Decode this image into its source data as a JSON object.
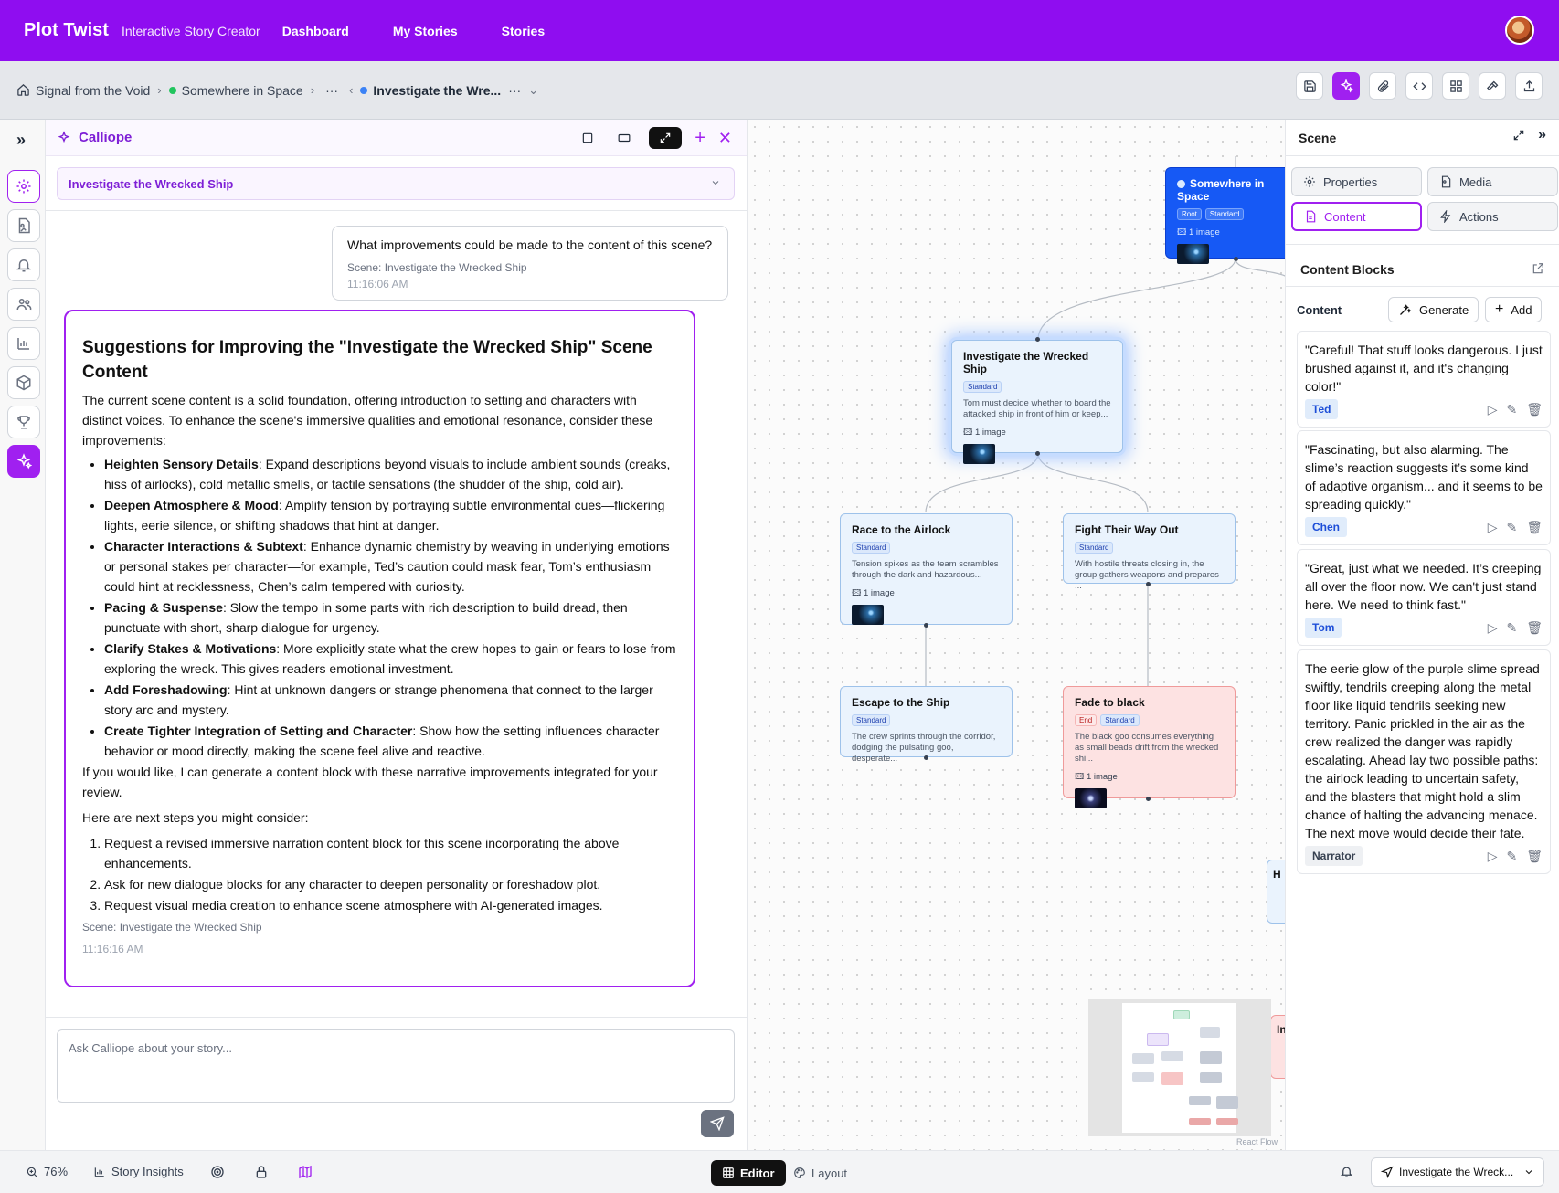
{
  "app": {
    "brand": "Plot Twist",
    "tagline": "Interactive Story Creator",
    "nav": [
      "Dashboard",
      "My Stories",
      "Stories"
    ]
  },
  "breadcrumb": {
    "story": "Signal from the Void",
    "scene_root": "Somewhere in Space",
    "ellipsis": "···",
    "current": "Investigate the Wre...",
    "colors": {
      "root_dot": "#22c55e",
      "current_dot": "#3b82f6"
    }
  },
  "calliope": {
    "title": "Calliope",
    "scene_selector": "Investigate the Wrecked Ship",
    "user_message": {
      "text": "What improvements could be made to the content of this scene?",
      "scene": "Scene: Investigate the Wrecked Ship",
      "time": "11:16:06 AM"
    },
    "ai_message": {
      "heading": "Suggestions for Improving the \"Investigate the Wrecked Ship\" Scene Content",
      "intro": "The current scene content is a solid foundation, offering introduction to setting and characters with distinct voices. To enhance the scene's immersive qualities and emotional resonance, consider these improvements:",
      "bullets": [
        {
          "b": "Heighten Sensory Details",
          "t": ": Expand descriptions beyond visuals to include ambient sounds (creaks, hiss of airlocks), cold metallic smells, or tactile sensations (the shudder of the ship, cold air)."
        },
        {
          "b": "Deepen Atmosphere & Mood",
          "t": ": Amplify tension by portraying subtle environmental cues—flickering lights, eerie silence, or shifting shadows that hint at danger."
        },
        {
          "b": "Character Interactions & Subtext",
          "t": ": Enhance dynamic chemistry by weaving in underlying emotions or personal stakes per character—for example, Ted’s caution could mask fear, Tom’s enthusiasm could hint at recklessness, Chen’s calm tempered with curiosity."
        },
        {
          "b": "Pacing & Suspense",
          "t": ": Slow the tempo in some parts with rich description to build dread, then punctuate with short, sharp dialogue for urgency."
        },
        {
          "b": "Clarify Stakes & Motivations",
          "t": ": More explicitly state what the crew hopes to gain or fears to lose from exploring the wreck. This gives readers emotional investment."
        },
        {
          "b": "Add Foreshadowing",
          "t": ": Hint at unknown dangers or strange phenomena that connect to the larger story arc and mystery."
        },
        {
          "b": "Create Tighter Integration of Setting and Character",
          "t": ": Show how the setting influences character behavior or mood directly, making the scene feel alive and reactive."
        }
      ],
      "offer": "If you would like, I can generate a content block with these narrative improvements integrated for your review.",
      "next_intro": "Here are next steps you might consider:",
      "steps": [
        "Request a revised immersive narration content block for this scene incorporating the above enhancements.",
        "Ask for new dialogue blocks for any character to deepen personality or foreshadow plot.",
        "Request visual media creation to enhance scene atmosphere with AI-generated images."
      ],
      "scene": "Scene: Investigate the Wrecked Ship",
      "time": "11:16:16 AM"
    },
    "input_placeholder": "Ask Calliope about your story..."
  },
  "canvas": {
    "nodes": {
      "root": {
        "title": "Somewhere in Space",
        "tags": [
          "Root",
          "Standard"
        ],
        "images": "1 image"
      },
      "investigate": {
        "title": "Investigate the Wrecked Ship",
        "tags": [
          "Standard"
        ],
        "desc": "Tom must decide whether to board the attacked ship in front of him or keep...",
        "images": "1 image"
      },
      "airlock": {
        "title": "Race to the Airlock",
        "tags": [
          "Standard"
        ],
        "desc": "Tension spikes as the team scrambles through the dark and hazardous...",
        "images": "1 image"
      },
      "fight": {
        "title": "Fight Their Way Out",
        "tags": [
          "Standard"
        ],
        "desc": "With hostile threats closing in, the group gathers weapons and prepares ..."
      },
      "escape": {
        "title": "Escape to the Ship",
        "tags": [
          "Standard"
        ],
        "desc": "The crew sprints through the corridor, dodging the pulsating goo, desperate..."
      },
      "fade": {
        "title": "Fade to black",
        "tags": [
          "End",
          "Standard"
        ],
        "desc": "The black goo consumes everything as small beads drift from the wrecked shi...",
        "images": "1 image"
      }
    },
    "partial_labels": {
      "h": "H",
      "i": "In"
    },
    "attribution": "React Flow"
  },
  "scene_panel": {
    "title": "Scene",
    "tabs": [
      "Properties",
      "Media",
      "Content",
      "Actions"
    ],
    "content_blocks_title": "Content Blocks",
    "content_label": "Content",
    "generate": "Generate",
    "add": "Add",
    "blocks": [
      {
        "text": "\"Careful! That stuff looks dangerous. I just brushed against it, and it's changing color!\"",
        "speaker": "Ted"
      },
      {
        "text": "\"Fascinating, but also alarming. The slime’s reaction suggests it’s some kind of adaptive organism... and it seems to be spreading quickly.\"",
        "speaker": "Chen"
      },
      {
        "text": "\"Great, just what we needed. It’s creeping all over the floor now. We can't just stand here. We need to think fast.\"",
        "speaker": "Tom"
      },
      {
        "text": "The eerie glow of the purple slime spread swiftly, tendrils creeping along the metal floor like liquid tendrils seeking new territory. Panic prickled in the air as the crew realized the danger was rapidly escalating. Ahead lay two possible paths: the airlock leading to uncertain safety, and the blasters that might hold a slim chance of halting the advancing menace. The next move would decide their fate.",
        "speaker": "Narrator"
      }
    ]
  },
  "bottom": {
    "zoom": "76%",
    "insights": "Story Insights",
    "editor": "Editor",
    "layout": "Layout",
    "scene_picker": "Investigate the Wreck..."
  },
  "colors": {
    "accent": "#a020f0",
    "nav_bg": "#8f0df0",
    "root_node": "#1659f5",
    "end_node": "#fde2e2"
  }
}
